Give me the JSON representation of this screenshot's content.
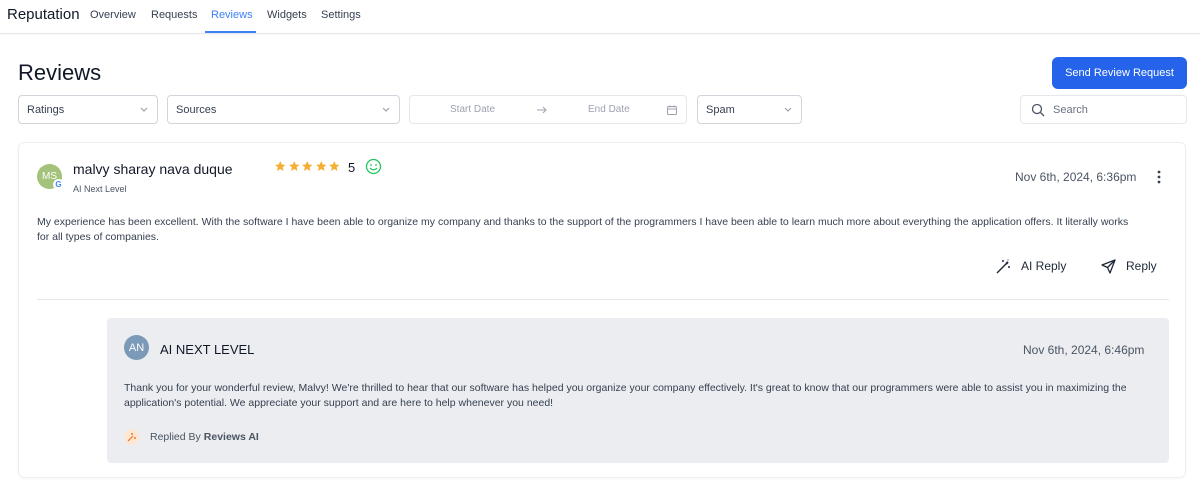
{
  "nav": {
    "brand": "Reputation",
    "tabs": [
      {
        "label": "Overview"
      },
      {
        "label": "Requests"
      },
      {
        "label": "Reviews",
        "active": true
      },
      {
        "label": "Widgets"
      },
      {
        "label": "Settings"
      }
    ]
  },
  "page": {
    "title": "Reviews",
    "send_request_label": "Send Review Request"
  },
  "filters": {
    "ratings": "Ratings",
    "sources": "Sources",
    "start_date": "Start Date",
    "end_date": "End Date",
    "spam": "Spam",
    "search_placeholder": "Search"
  },
  "review": {
    "initials": "MS",
    "source_icon": "google-icon",
    "source_badge": "G",
    "name": "malvy sharay nava duque",
    "subtitle": "AI Next Level",
    "rating": 5,
    "rating_label": "5",
    "sentiment_icon": "smile-icon",
    "date": "Nov 6th, 2024, 6:36pm",
    "text": "My experience has been excellent. With the software I have been able to organize my company and thanks to the support of the programmers I have been able to learn much more about everything the application offers. It literally works for all types of companies.",
    "ai_reply_label": "AI Reply",
    "reply_label": "Reply"
  },
  "reply": {
    "initials": "AN",
    "name": "AI NEXT LEVEL",
    "date": "Nov 6th, 2024, 6:46pm",
    "text": "Thank you for your wonderful review, Malvy! We're thrilled to hear that our software has helped you organize your company effectively. It's great to know that our programmers were able to assist you in maximizing the application's potential. We appreciate your support and are here to help whenever you need!",
    "replied_by_prefix": "Replied By",
    "replied_by_name": "Reviews AI"
  },
  "colors": {
    "accent": "#2563eb",
    "active_tab": "#3b82f6",
    "star": "#f5b034",
    "sentiment_positive": "#22c55e",
    "reply_bg": "#ebedf0"
  }
}
